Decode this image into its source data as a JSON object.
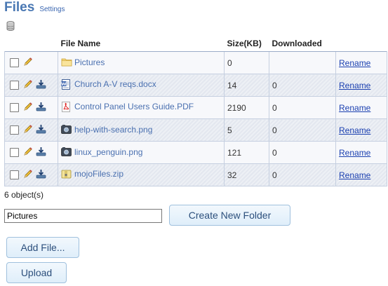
{
  "header": {
    "title": "Files",
    "settings_label": "Settings"
  },
  "table": {
    "columns": [
      "",
      "File Name",
      "Size(KB)",
      "Downloaded",
      ""
    ],
    "rows": [
      {
        "name": "Pictures",
        "type": "folder",
        "size": "0",
        "downloaded": "",
        "action": "Rename"
      },
      {
        "name": "Church A-V reqs.docx",
        "type": "doc",
        "size": "14",
        "downloaded": "0",
        "action": "Rename"
      },
      {
        "name": "Control Panel Users Guide.PDF",
        "type": "pdf",
        "size": "2190",
        "downloaded": "0",
        "action": "Rename"
      },
      {
        "name": "help-with-search.png",
        "type": "image",
        "size": "5",
        "downloaded": "0",
        "action": "Rename"
      },
      {
        "name": "linux_penguin.png",
        "type": "image",
        "size": "121",
        "downloaded": "0",
        "action": "Rename"
      },
      {
        "name": "mojoFiles.zip",
        "type": "zip",
        "size": "32",
        "downloaded": "0",
        "action": "Rename"
      }
    ]
  },
  "footer": {
    "count_text": "6 object(s)",
    "folder_input_value": "Pictures",
    "create_folder_label": "Create New Folder",
    "add_file_label": "Add File...",
    "upload_label": "Upload"
  },
  "icons": {
    "database": "database-icon",
    "edit": "pencil-icon",
    "download": "download-icon",
    "folder": "folder-icon",
    "doc": "word-document-icon",
    "pdf": "pdf-icon",
    "image": "image-file-icon",
    "zip": "zip-archive-icon"
  }
}
